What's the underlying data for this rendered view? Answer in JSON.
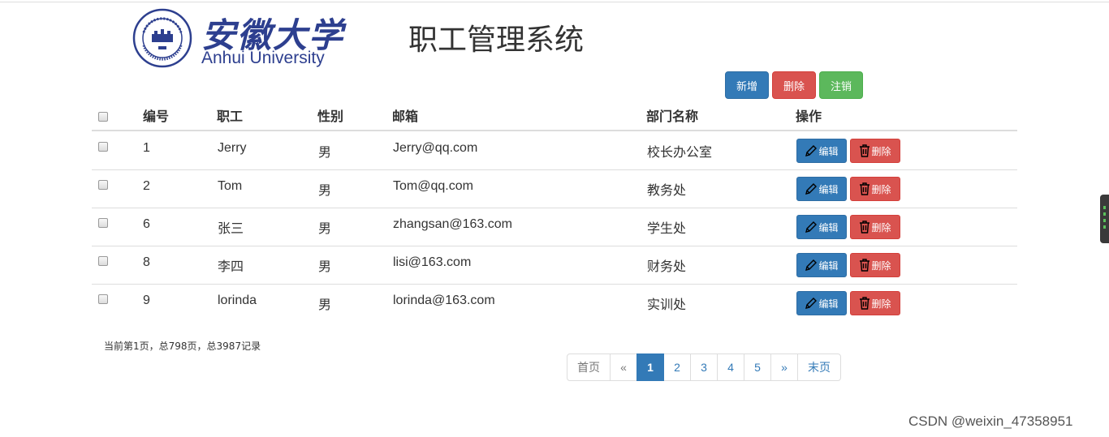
{
  "logo": {
    "name_cn": "安徽大学",
    "name_en": "Anhui University"
  },
  "page_title": "职工管理系统",
  "toolbar": {
    "add_label": "新增",
    "delete_label": "删除",
    "logout_label": "注销"
  },
  "table": {
    "headers": {
      "id": "编号",
      "name": "职工",
      "gender": "性别",
      "email": "邮箱",
      "dept": "部门名称",
      "action": "操作"
    },
    "rows": [
      {
        "id": "1",
        "name": "Jerry",
        "gender": "男",
        "email": "Jerry@qq.com",
        "dept": "校长办公室",
        "edit": "编辑",
        "del": "删除"
      },
      {
        "id": "2",
        "name": "Tom",
        "gender": "男",
        "email": "Tom@qq.com",
        "dept": "教务处",
        "edit": "编辑",
        "del": "删除"
      },
      {
        "id": "6",
        "name": "张三",
        "gender": "男",
        "email": "zhangsan@163.com",
        "dept": "学生处",
        "edit": "编辑",
        "del": "删除"
      },
      {
        "id": "8",
        "name": "李四",
        "gender": "男",
        "email": "lisi@163.com",
        "dept": "财务处",
        "edit": "编辑",
        "del": "删除"
      },
      {
        "id": "9",
        "name": "lorinda",
        "gender": "男",
        "email": "lorinda@163.com",
        "dept": "实训处",
        "edit": "编辑",
        "del": "删除"
      }
    ]
  },
  "page_info": "当前第1页，总798页，总3987记录",
  "pagination": {
    "first": "首页",
    "prev": "«",
    "pages": [
      "1",
      "2",
      "3",
      "4",
      "5"
    ],
    "active_page": "1",
    "next": "»",
    "last": "末页"
  },
  "watermark": "CSDN @weixin_47358951",
  "colors": {
    "primary": "#337ab7",
    "danger": "#d9534f",
    "success": "#5cb85c",
    "logo_blue": "#2d3f8f"
  },
  "icons": {
    "edit": "pencil-icon",
    "delete": "trash-icon"
  }
}
